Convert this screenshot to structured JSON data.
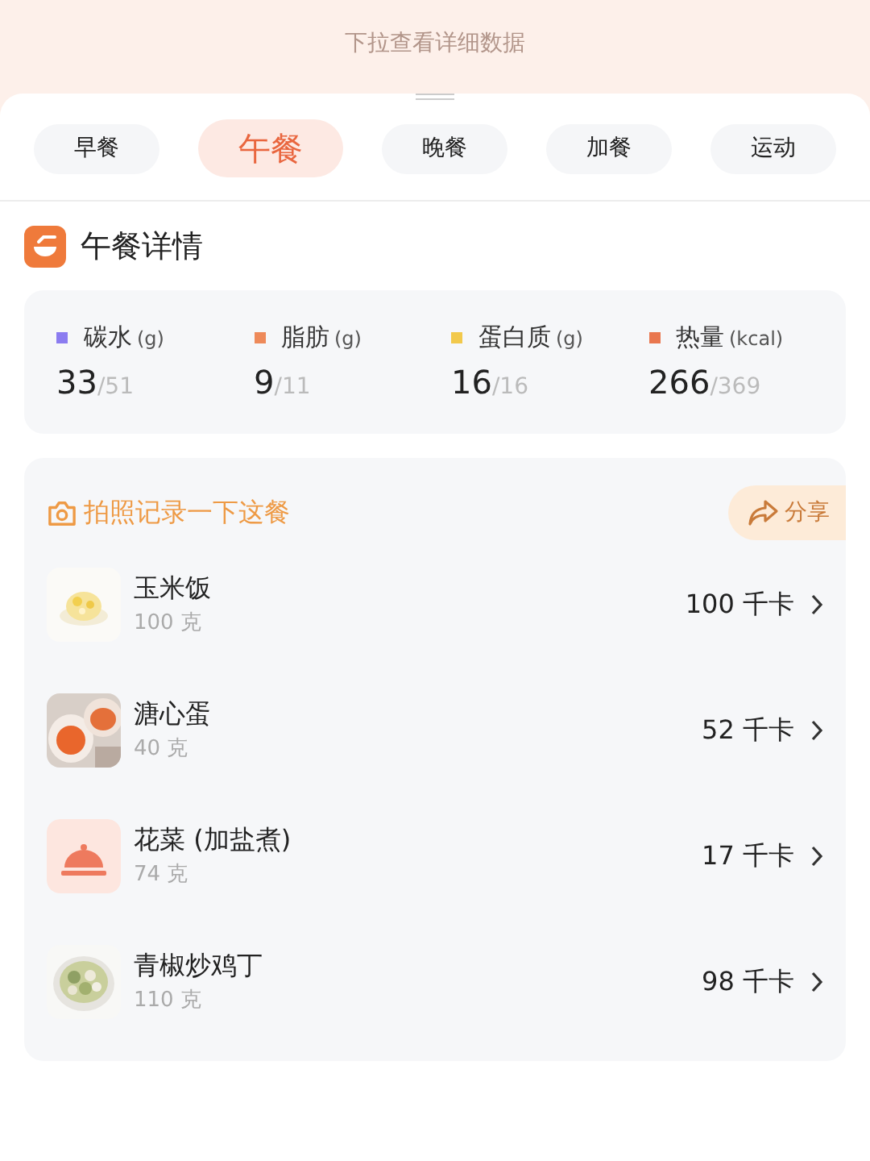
{
  "banner": {
    "hint": "下拉查看详细数据"
  },
  "tabs": [
    {
      "label": "早餐",
      "selected": false
    },
    {
      "label": "午餐",
      "selected": true
    },
    {
      "label": "晚餐",
      "selected": false
    },
    {
      "label": "加餐",
      "selected": false
    },
    {
      "label": "运动",
      "selected": false
    }
  ],
  "section": {
    "title": "午餐详情"
  },
  "nutrients": [
    {
      "name": "碳水",
      "unit": "(g)",
      "value": "33",
      "target": "/51",
      "color": "#8b7cf0"
    },
    {
      "name": "脂肪",
      "unit": "(g)",
      "value": "9",
      "target": "/11",
      "color": "#ee8a5a"
    },
    {
      "name": "蛋白质",
      "unit": "(g)",
      "value": "16",
      "target": "/16",
      "color": "#f2c94c"
    },
    {
      "name": "热量",
      "unit": "(kcal)",
      "value": "266",
      "target": "/369",
      "color": "#e9774f"
    }
  ],
  "meal": {
    "photo_prompt": "拍照记录一下这餐",
    "share": "分享",
    "foods": [
      {
        "name": "玉米饭",
        "amount": "100 克",
        "calories": "100 千卡"
      },
      {
        "name": "溏心蛋",
        "amount": "40 克",
        "calories": "52 千卡"
      },
      {
        "name": "花菜 (加盐煮)",
        "amount": "74 克",
        "calories": "17 千卡",
        "thumb": {
          "kind": "icon"
        }
      },
      {
        "name": "青椒炒鸡丁",
        "amount": "110 克",
        "calories": "98 千卡"
      }
    ]
  }
}
